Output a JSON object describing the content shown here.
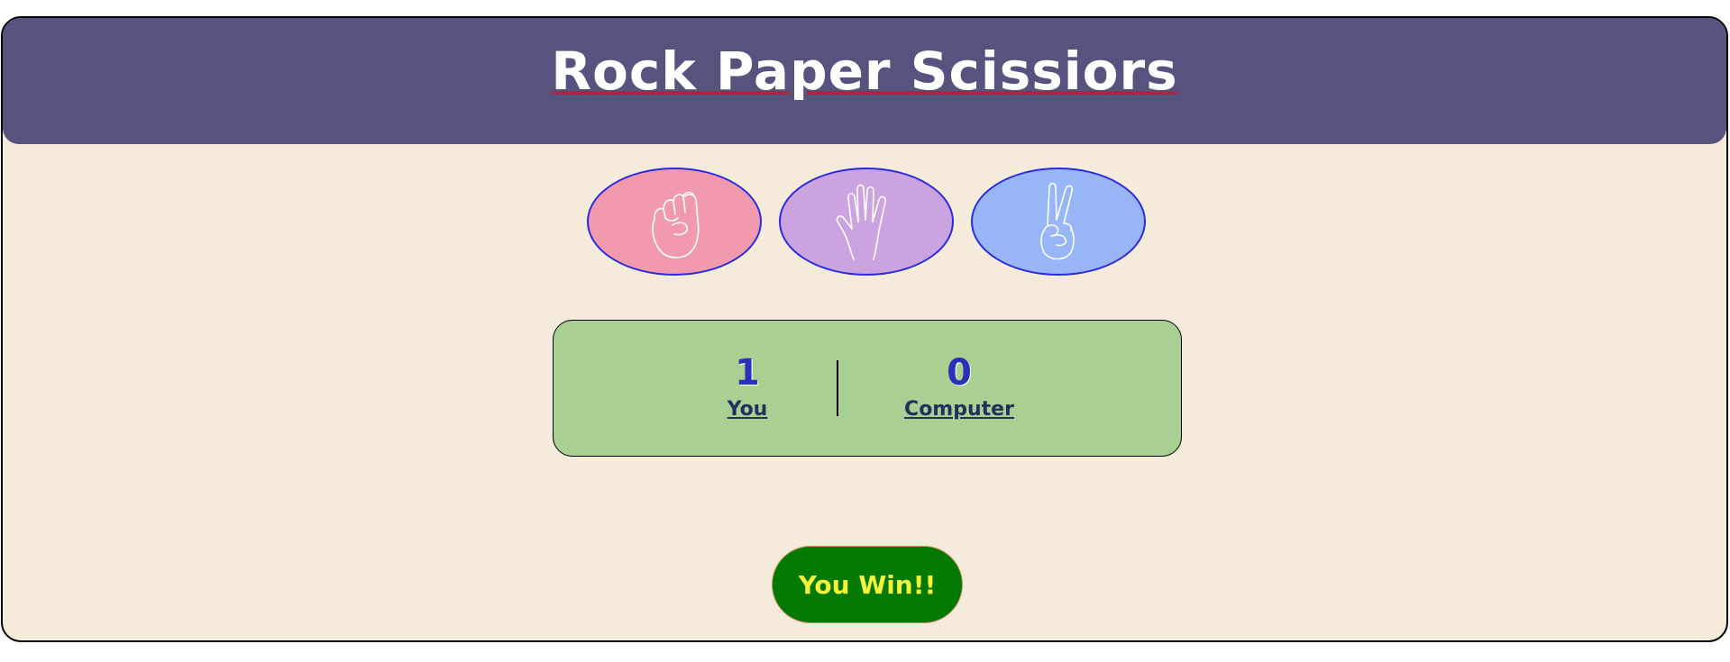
{
  "header": {
    "title": "Rock Paper Scissiors"
  },
  "choices": [
    {
      "id": "rock",
      "icon": "rock-fist-icon",
      "color": "#f19aae"
    },
    {
      "id": "paper",
      "icon": "paper-hand-icon",
      "color": "#cba3e0"
    },
    {
      "id": "scissors",
      "icon": "scissors-hand-icon",
      "color": "#98b6f7"
    }
  ],
  "scoreboard": {
    "user": {
      "score": "1",
      "label": "You"
    },
    "computer": {
      "score": "0",
      "label": "Computer"
    }
  },
  "result": {
    "message": "You Win!!",
    "background": "#027a02",
    "text_color": "#f6f23a"
  },
  "colors": {
    "header_bg": "#56547e",
    "page_bg": "#f5ebda",
    "scoreboard_bg": "#a8d093",
    "title_underline": "#9c2b45"
  }
}
